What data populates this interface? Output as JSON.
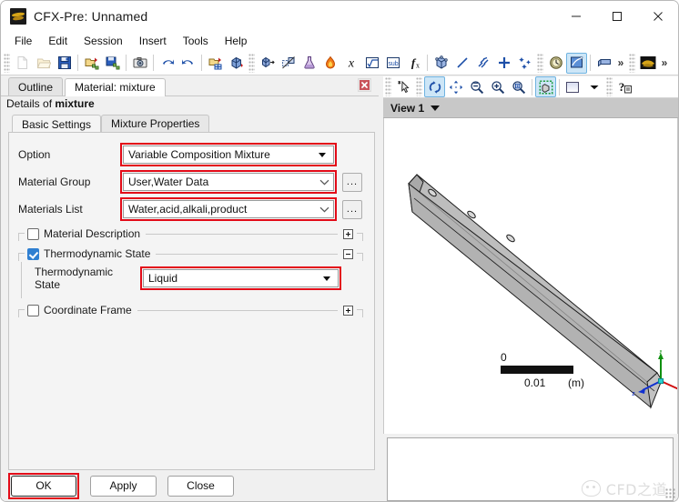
{
  "window": {
    "title": "CFX-Pre:  Unnamed",
    "icon": "cfx-app-icon",
    "minimize": "—",
    "maximize": "□",
    "close": "✕"
  },
  "menubar": {
    "items": [
      {
        "label": "File"
      },
      {
        "label": "Edit"
      },
      {
        "label": "Session"
      },
      {
        "label": "Insert"
      },
      {
        "label": "Tools"
      },
      {
        "label": "Help"
      }
    ]
  },
  "toolbar": {
    "groups": [
      {
        "buttons": [
          {
            "icon": "new-file-icon",
            "disabled": true
          },
          {
            "icon": "open-folder-icon",
            "disabled": true
          },
          {
            "icon": "save-icon",
            "disabled": false
          },
          {
            "sep": true
          },
          {
            "icon": "import-mesh-icon",
            "disabled": false
          },
          {
            "icon": "export-mesh-icon",
            "disabled": false
          },
          {
            "sep": true
          },
          {
            "icon": "snapshot-camera-icon",
            "disabled": false
          },
          {
            "sep": true
          },
          {
            "icon": "undo-icon",
            "disabled": false
          },
          {
            "icon": "redo-icon",
            "disabled": false
          },
          {
            "sep": true
          },
          {
            "icon": "open-case-icon",
            "disabled": false
          },
          {
            "icon": "mesh-refresh-icon",
            "disabled": false
          }
        ]
      },
      {
        "buttons": [
          {
            "icon": "domain-icon",
            "disabled": false
          },
          {
            "icon": "boundary-icon",
            "disabled": false
          },
          {
            "icon": "material-flask-icon",
            "disabled": false
          },
          {
            "icon": "reaction-flame-icon",
            "disabled": false
          },
          {
            "icon": "expression-icon",
            "disabled": false
          },
          {
            "icon": "variable-icon",
            "disabled": false
          },
          {
            "icon": "subdomain-icon",
            "disabled": false
          },
          {
            "icon": "function-icon",
            "disabled": false
          },
          {
            "sep": true
          },
          {
            "icon": "mesh-region-icon",
            "disabled": false
          },
          {
            "icon": "line-icon",
            "disabled": false
          },
          {
            "icon": "vector-icon",
            "disabled": false
          },
          {
            "icon": "point-icon",
            "disabled": false
          },
          {
            "icon": "particle-icon",
            "disabled": false
          }
        ]
      },
      {
        "buttons": [
          {
            "icon": "timestep-clock-icon",
            "disabled": false
          },
          {
            "icon": "solver-run-icon",
            "disabled": false,
            "active": true
          },
          {
            "sep": true
          },
          {
            "icon": "box-render-icon",
            "disabled": false
          }
        ],
        "overflow": "»"
      },
      {
        "buttons": [
          {
            "icon": "cfx-launcher-icon",
            "disabled": false
          }
        ],
        "overflow": "»"
      }
    ]
  },
  "left_pane": {
    "tabs": [
      {
        "label": "Outline",
        "active": false
      },
      {
        "label": "Material: mixture",
        "active": true
      }
    ],
    "close_tab_icon": "close-tab-icon",
    "details_prefix": "Details of ",
    "details_name": "mixture",
    "sub_tabs": [
      {
        "label": "Basic Settings",
        "active": true
      },
      {
        "label": "Mixture Properties",
        "active": false
      }
    ],
    "form": {
      "rows": [
        {
          "label": "Option",
          "value": "Variable Composition Mixture",
          "arrow": "solid",
          "highlight": true,
          "ellipsis": false,
          "width_class": "w-opt"
        },
        {
          "label": "Material Group",
          "value": "User,Water Data",
          "arrow": "thin",
          "highlight": true,
          "ellipsis": true,
          "width_class": "w-grp"
        },
        {
          "label": "Materials List",
          "value": "Water,acid,alkali,product",
          "arrow": "thin",
          "highlight": true,
          "ellipsis": true,
          "width_class": "w-mat"
        }
      ],
      "ellipsis_label": "...",
      "groups": [
        {
          "title": "Material Description",
          "checked": false,
          "expander": "plus",
          "expanded": false
        },
        {
          "title": "Thermodynamic State",
          "checked": true,
          "expander": "minus",
          "expanded": true,
          "inner": {
            "label": "Thermodynamic State",
            "value": "Liquid",
            "arrow": "solid",
            "highlight": true
          }
        },
        {
          "title": "Coordinate Frame",
          "checked": false,
          "expander": "plus",
          "expanded": false
        }
      ]
    },
    "buttons": [
      {
        "label": "OK",
        "highlight": true
      },
      {
        "label": "Apply",
        "highlight": false
      },
      {
        "label": "Close",
        "highlight": false
      }
    ]
  },
  "right_pane": {
    "toolbar": [
      {
        "icon": "select-pointer-icon"
      },
      {
        "sep": true
      },
      {
        "icon": "rotate-icon",
        "active": true
      },
      {
        "icon": "pan-icon"
      },
      {
        "icon": "zoom-out-icon"
      },
      {
        "icon": "zoom-in-icon"
      },
      {
        "icon": "zoom-box-icon"
      },
      {
        "sep": true
      },
      {
        "icon": "fit-view-icon",
        "active": true
      },
      {
        "sep": true
      },
      {
        "icon": "background-color-icon"
      },
      {
        "icon": "chevron-down-icon"
      },
      {
        "sep": true
      },
      {
        "icon": "help-whatsthis-icon"
      }
    ],
    "view_label": "View 1",
    "view_caret": "chevron-down-icon",
    "scale_bar": {
      "min": "0",
      "max": "0.01",
      "unit": "(m)"
    },
    "axis_triad": {
      "x": "x",
      "y": "y",
      "z": "z",
      "x_color": "#d01010",
      "y_color": "#109010",
      "z_color": "#1030d0"
    },
    "geometry": {
      "name": "triangular-channel-prism",
      "fill": "#b6b6b6",
      "fill_side": "#a8a8a8",
      "stroke": "#1a1a1a",
      "holes": 3
    },
    "watermark": {
      "icon": "wechat-icon",
      "text": "CFD之道"
    }
  }
}
